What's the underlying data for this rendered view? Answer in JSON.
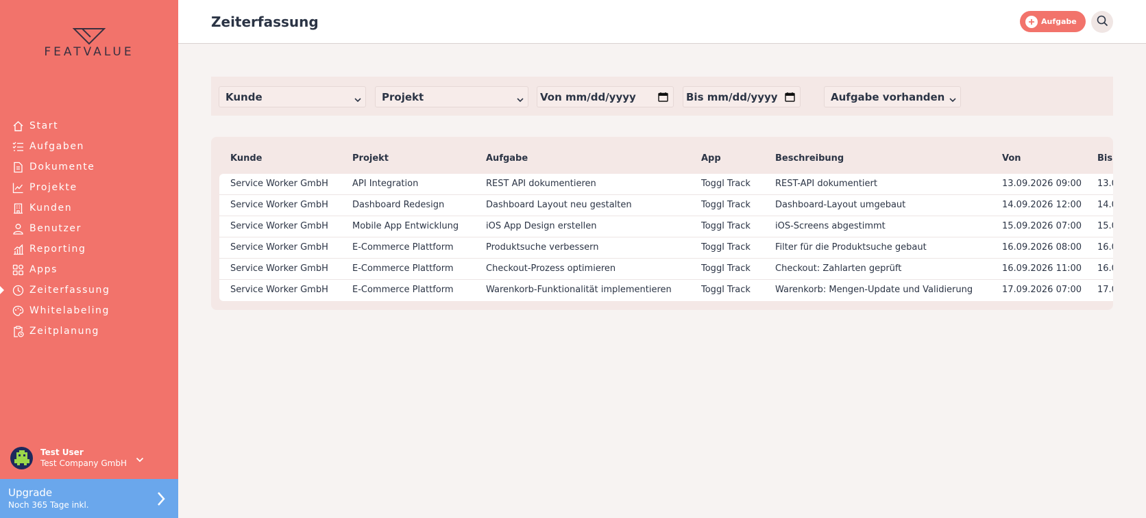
{
  "sidebar": {
    "logo_text": "FEATVALUE",
    "items": [
      {
        "label": "Start",
        "icon": "home-icon"
      },
      {
        "label": "Aufgaben",
        "icon": "task-list-icon"
      },
      {
        "label": "Dokumente",
        "icon": "document-icon"
      },
      {
        "label": "Projekte",
        "icon": "chart-icon"
      },
      {
        "label": "Kunden",
        "icon": "building-icon"
      },
      {
        "label": "Benutzer",
        "icon": "user-icon"
      },
      {
        "label": "Reporting",
        "icon": "bar-chart-icon"
      },
      {
        "label": "Apps",
        "icon": "apps-grid-icon"
      },
      {
        "label": "Zeiterfassung",
        "icon": "clock-icon",
        "active": true
      },
      {
        "label": "Whitelabeling",
        "icon": "palette-icon"
      },
      {
        "label": "Zeitplanung",
        "icon": "clipboard-clock-icon"
      }
    ],
    "user": {
      "name": "Test User",
      "company": "Test Company GmbH"
    },
    "upgrade": {
      "title": "Upgrade",
      "subtitle": "Noch 365 Tage inkl."
    }
  },
  "header": {
    "title": "Zeiterfassung",
    "add_label": "Aufgabe"
  },
  "filters": {
    "kunde": "Kunde",
    "projekt": "Projekt",
    "von": "Von mm/dd/yyyy",
    "bis": "Bis mm/dd/yyyy",
    "aufgabe": "Aufgabe vorhanden"
  },
  "table": {
    "columns": [
      "Kunde",
      "Projekt",
      "Aufgabe",
      "App",
      "Beschreibung",
      "Von",
      "Bis"
    ],
    "rows": [
      [
        "Service Worker GmbH",
        "API Integration",
        "REST API dokumentieren",
        "Toggl Track",
        "REST-API dokumentiert",
        "13.09.2026 09:00",
        "13.0"
      ],
      [
        "Service Worker GmbH",
        "Dashboard Redesign",
        "Dashboard Layout neu gestalten",
        "Toggl Track",
        "Dashboard-Layout umgebaut",
        "14.09.2026 12:00",
        "14.0"
      ],
      [
        "Service Worker GmbH",
        "Mobile App Entwicklung",
        "iOS App Design erstellen",
        "Toggl Track",
        "iOS-Screens abgestimmt",
        "15.09.2026 07:00",
        "15.0"
      ],
      [
        "Service Worker GmbH",
        "E-Commerce Plattform",
        "Produktsuche verbessern",
        "Toggl Track",
        "Filter für die Produktsuche gebaut",
        "16.09.2026 08:00",
        "16.0"
      ],
      [
        "Service Worker GmbH",
        "E-Commerce Plattform",
        "Checkout-Prozess optimieren",
        "Toggl Track",
        "Checkout: Zahlarten geprüft",
        "16.09.2026 11:00",
        "16.0"
      ],
      [
        "Service Worker GmbH",
        "E-Commerce Plattform",
        "Warenkorb-Funktionalität implementieren",
        "Toggl Track",
        "Warenkorb: Mengen-Update und Validierung",
        "17.09.2026 07:00",
        "17.0"
      ]
    ]
  },
  "colors": {
    "sidebar": "#f2736b",
    "accent": "#f2736b",
    "upgrade": "#6aa7ec",
    "text": "#2b3445"
  }
}
